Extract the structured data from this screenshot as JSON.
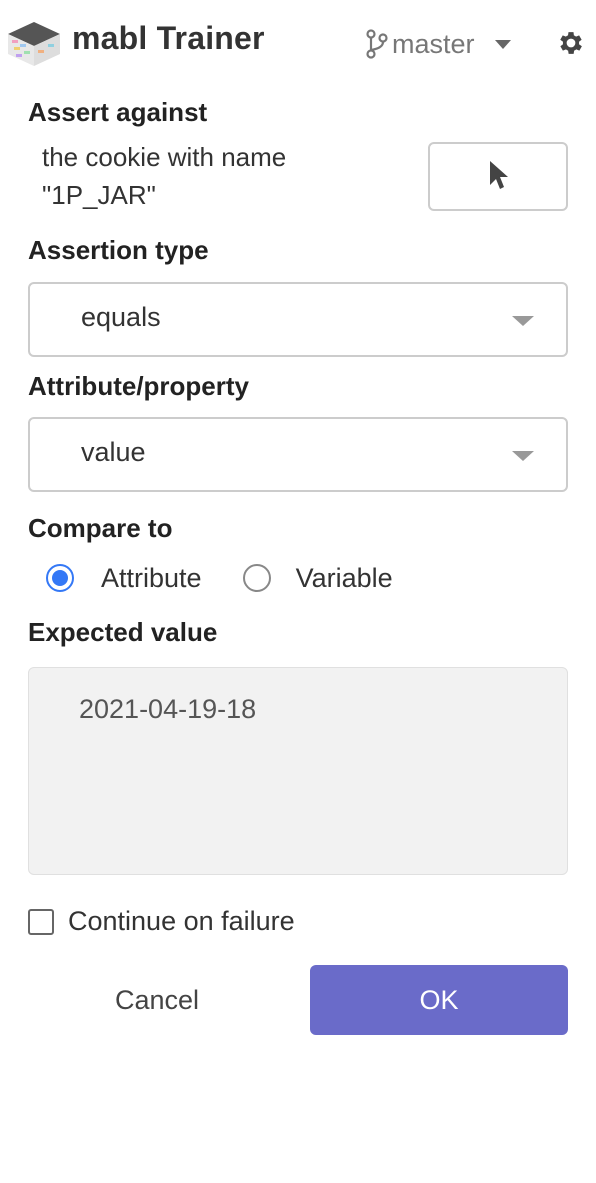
{
  "header": {
    "app_title": "mabl Trainer",
    "branch": "master",
    "logo_icon": "mabl-logo-icon",
    "branch_icon": "git-branch-icon",
    "settings_icon": "gear-icon"
  },
  "assert_against": {
    "label": "Assert against",
    "target_line1": "the cookie with name",
    "target_line2": "\"1P_JAR\"",
    "picker_icon": "cursor-pointer-icon"
  },
  "assertion_type": {
    "label": "Assertion type",
    "selected": "equals"
  },
  "attribute_property": {
    "label": "Attribute/property",
    "selected": "value"
  },
  "compare_to": {
    "label": "Compare to",
    "options": [
      {
        "label": "Attribute",
        "checked": true
      },
      {
        "label": "Variable",
        "checked": false
      }
    ]
  },
  "expected_value": {
    "label": "Expected value",
    "value": "2021-04-19-18"
  },
  "continue_on_failure": {
    "label": "Continue on failure",
    "checked": false
  },
  "actions": {
    "cancel": "Cancel",
    "ok": "OK"
  },
  "colors": {
    "accent": "#6a6bc9",
    "radio": "#3478f6"
  }
}
